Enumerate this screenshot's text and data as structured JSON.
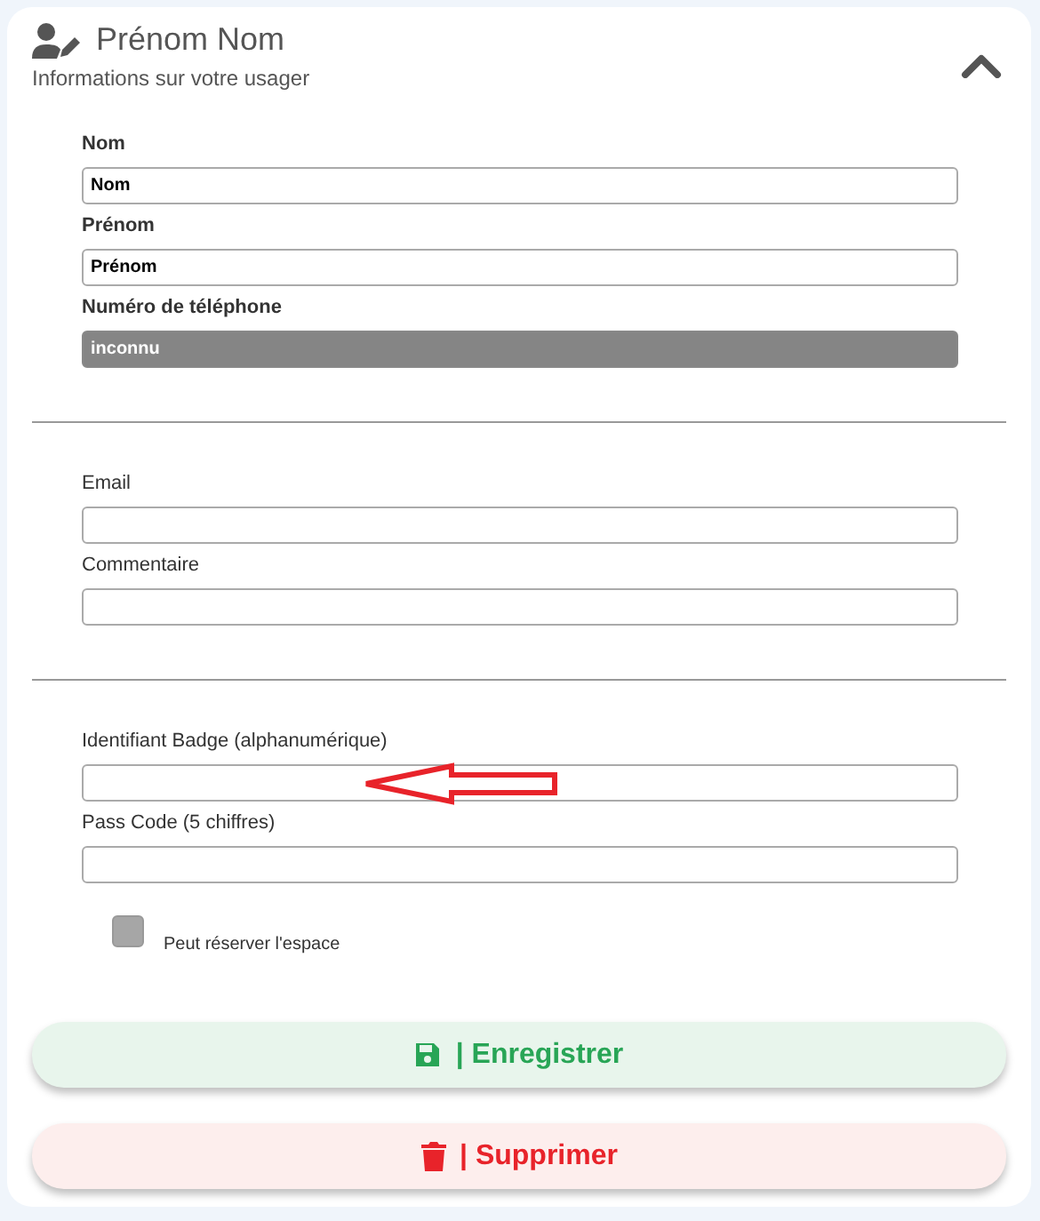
{
  "header": {
    "title": "Prénom Nom",
    "subtitle": "Informations sur votre usager",
    "expanded": true
  },
  "sections": [
    {
      "kind": "identity",
      "fields": [
        {
          "label": "Nom",
          "value": "Nom",
          "disabled": false
        },
        {
          "label": "Prénom",
          "value": "Prénom",
          "disabled": false
        },
        {
          "label": "Numéro de téléphone",
          "value": "inconnu",
          "disabled": true
        }
      ]
    },
    {
      "kind": "plain",
      "fields": [
        {
          "label": "Email",
          "disabled": false
        },
        {
          "label": "Commentaire",
          "disabled": false
        }
      ]
    },
    {
      "kind": "plain",
      "fields": [
        {
          "label": "Identifiant Badge (alphanumérique)",
          "disabled": false,
          "annotated": true
        },
        {
          "label": "Pass Code (5 chiffres)",
          "disabled": false
        }
      ]
    }
  ],
  "checkbox": {
    "label": "Peut réserver l'espace",
    "checked": false
  },
  "buttons": [
    {
      "kind": "save",
      "label": "| Enregistrer"
    },
    {
      "kind": "delete",
      "label": "| Supprimer"
    }
  ]
}
